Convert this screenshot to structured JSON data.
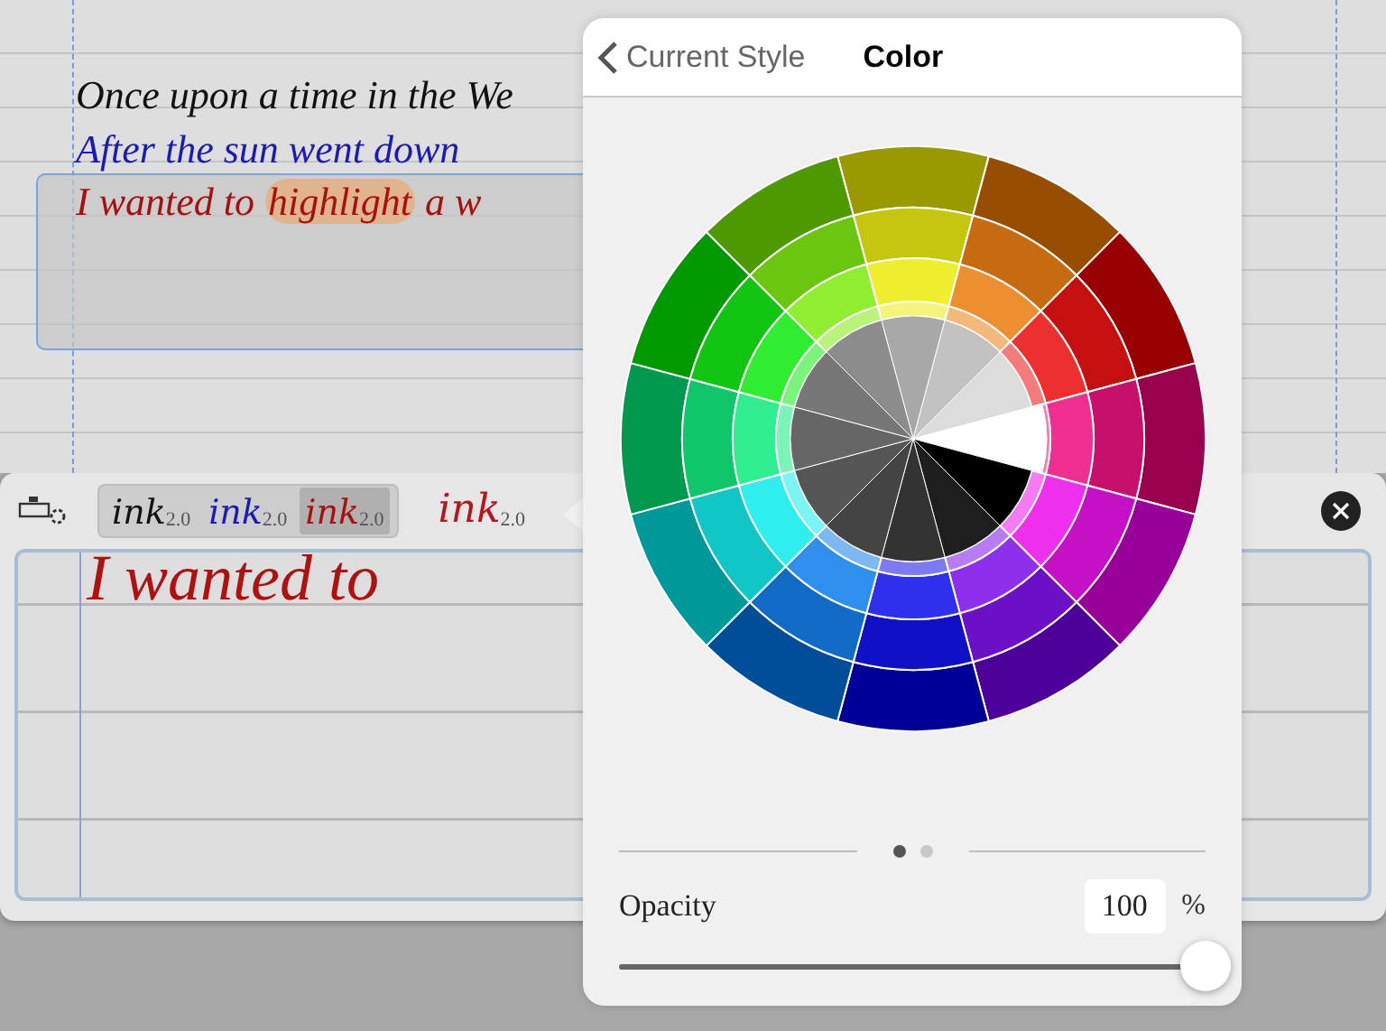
{
  "notebook": {
    "lines": [
      {
        "color": "#111111",
        "segments": [
          {
            "text": "Once upon a time in the We",
            "highlighted": false
          }
        ]
      },
      {
        "color": "#1a1ab8",
        "segments": [
          {
            "text": "After the sun went down",
            "highlighted": false
          }
        ]
      },
      {
        "color": "#a81010",
        "segments": [
          {
            "text": "I wanted to ",
            "highlighted": false
          },
          {
            "text": "highlight",
            "highlighted": true
          },
          {
            "text": " a w",
            "highlighted": false
          }
        ]
      }
    ]
  },
  "toolbar": {
    "pen_presets": [
      {
        "label": "ink",
        "size": "2.0",
        "color": "#111111",
        "selected": false
      },
      {
        "label": "ink",
        "size": "2.0",
        "color": "#1a1ab8",
        "selected": false
      },
      {
        "label": "ink",
        "size": "2.0",
        "color": "#a81010",
        "selected": true
      }
    ],
    "current_pen": {
      "label": "ink",
      "size": "2.0",
      "color": "#b8141e"
    }
  },
  "writing_area": {
    "text": "I wanted to",
    "color": "#b01010"
  },
  "popover": {
    "back_label": "Current Style",
    "title": "Color",
    "pages": [
      {
        "selected": true
      },
      {
        "selected": false
      }
    ],
    "opacity": {
      "label": "Opacity",
      "value": "100",
      "unit": "%",
      "level": 1
    }
  }
}
